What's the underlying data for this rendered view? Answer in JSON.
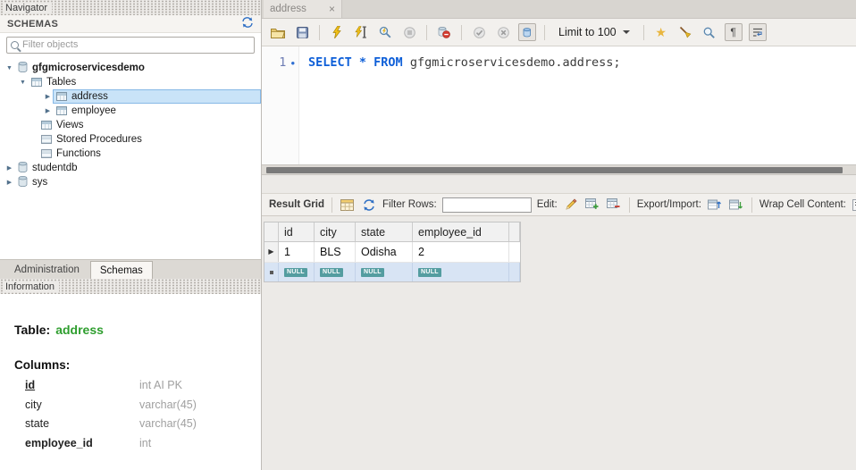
{
  "colors": {
    "keyword_blue": "#0E5FD8",
    "table_name_green": "#2E9E2E",
    "null_badge_teal": "#549DA0",
    "tree_selection_blue": "#C9E3F8",
    "insert_row_blue": "#D8E4F4"
  },
  "icons": {
    "close": "×",
    "expanded_arrow": "▼",
    "collapsed_arrow": "▶",
    "row_pointer": "▶",
    "star": "★",
    "plus": "+",
    "pilcrow": "¶"
  },
  "navigator": {
    "title": "Navigator",
    "schemas_header": "SCHEMAS",
    "filter_placeholder": "Filter objects",
    "tree": [
      {
        "label": "gfgmicroservicesdemo"
      },
      {
        "label": "Tables"
      },
      {
        "label": "address"
      },
      {
        "label": "employee"
      },
      {
        "label": "Views"
      },
      {
        "label": "Stored Procedures"
      },
      {
        "label": "Functions"
      },
      {
        "label": "studentdb"
      },
      {
        "label": "sys"
      }
    ],
    "tabs": [
      {
        "label": "Administration"
      },
      {
        "label": "Schemas"
      }
    ],
    "information_title": "Information"
  },
  "info": {
    "table_label": "Table:",
    "table_name": "address",
    "columns_label": "Columns:",
    "columns": [
      {
        "name": "id",
        "type": "int AI PK"
      },
      {
        "name": "city",
        "type": "varchar(45)"
      },
      {
        "name": "state",
        "type": "varchar(45)"
      },
      {
        "name": "employee_id",
        "type": "int"
      }
    ]
  },
  "editor": {
    "tab_title": "address",
    "limit_label": "Limit to 100",
    "line_number": "1",
    "bullet": "•",
    "sql": [
      {
        "text": "SELECT"
      },
      {
        "text": " * "
      },
      {
        "text": "FROM"
      },
      {
        "text": " gfgmicroservicesdemo.address;"
      }
    ]
  },
  "result": {
    "grid_label": "Result Grid",
    "filter_label": "Filter Rows:",
    "filter_value": "",
    "edit_label": "Edit:",
    "export_label": "Export/Import:",
    "wrap_label": "Wrap Cell Content:",
    "columns": [
      "id",
      "city",
      "state",
      "employee_id"
    ],
    "rows": [
      [
        "1",
        "BLS",
        "Odisha",
        "2"
      ]
    ],
    "null_badge": "NULL"
  }
}
